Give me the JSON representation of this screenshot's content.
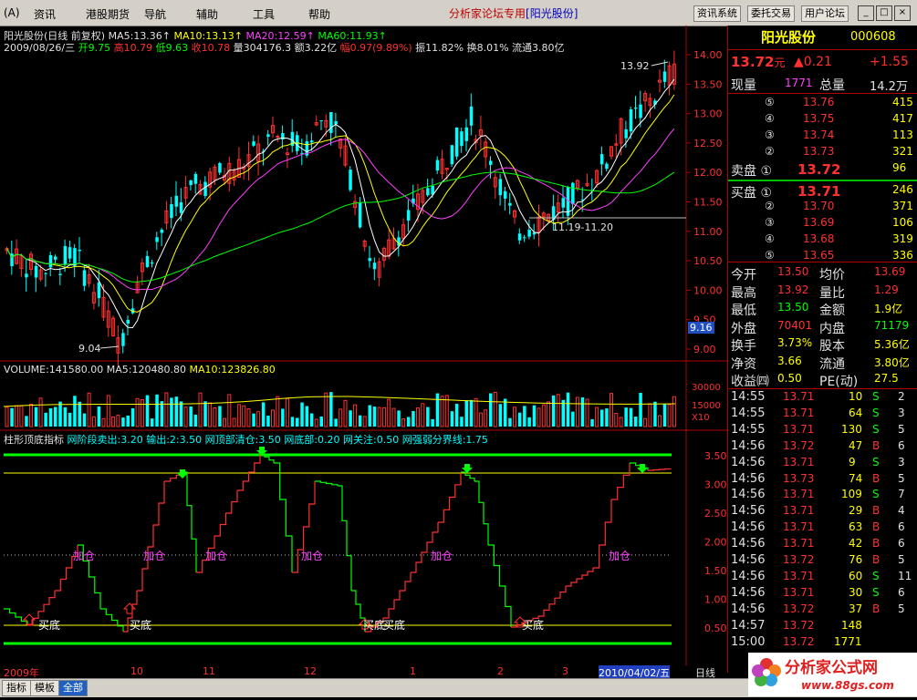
{
  "menu": [
    "(A)",
    "资讯",
    "港股期货",
    "导航",
    "辅助",
    "工具",
    "帮助"
  ],
  "window_title": {
    "prefix": "分析家论坛专用",
    "stock": "[阳光股份]"
  },
  "toolbar_buttons": [
    "资讯系统",
    "委托交易",
    "用户论坛"
  ],
  "window_controls": [
    "_",
    "□",
    "×"
  ],
  "chart_header": {
    "title": "阳光股份(日线 前复权)",
    "ma5": "MA5:13.36↑",
    "ma10": "MA10:13.13↑",
    "ma20": "MA20:12.59↑",
    "ma60": "MA60:11.93↑",
    "date": "2009/08/26/三",
    "open": "开9.75",
    "high": "高10.79",
    "low": "低9.63",
    "close": "收10.78",
    "volume": "量304176.3",
    "amount": "额3.22亿",
    "change": "幅0.97(9.89%)",
    "amplitude": "振11.82%",
    "turnover": "换8.01%",
    "float": "流通3.80亿"
  },
  "price_axis": [
    "14.00",
    "13.50",
    "13.00",
    "12.50",
    "12.00",
    "11.50",
    "11.00",
    "10.50",
    "10.00",
    "9.50",
    "9.00"
  ],
  "annotations": {
    "high": "13.92",
    "low": "9.04",
    "range": "11.19-11.20",
    "current_tag": "9.16"
  },
  "volume_header": {
    "label": "VOLUME:141580.00",
    "ma5": "MA5:120480.80",
    "ma10": "MA10:123826.80"
  },
  "volume_axis": [
    "30000",
    "15000",
    "X10"
  ],
  "indicator_header": {
    "name": "柱形顶底指标",
    "sell": "网阶段卖出:3.20",
    "out": "输出:2:3.50",
    "top": "网顶部清仓:3.50",
    "bottom": "网底部:0.20",
    "focus": "网关注:0.50",
    "line": "网强弱分界线:1.75"
  },
  "indicator_axis": [
    "3.50",
    "3.00",
    "2.50",
    "2.00",
    "1.50",
    "1.00",
    "0.50"
  ],
  "indicator_labels": {
    "add": "加仓",
    "buy": "买底"
  },
  "date_axis": [
    "2009年",
    "10",
    "11",
    "12",
    "1",
    "2",
    "3"
  ],
  "date_cursor": "2010/04/02/五",
  "period": "日线",
  "tabs": [
    "指标",
    "模板",
    "全部"
  ],
  "quote": {
    "name": "阳光股份",
    "code": "000608",
    "price": "13.72",
    "unit": "元",
    "change": "▲0.21",
    "pct": "+1.55",
    "cur_vol_label": "现量",
    "cur_vol": "1771",
    "total_vol_label": "总量",
    "total_vol": "14.2万",
    "asks": [
      {
        "lv": "⑤",
        "p": "13.76",
        "v": "415"
      },
      {
        "lv": "④",
        "p": "13.75",
        "v": "417"
      },
      {
        "lv": "③",
        "p": "13.74",
        "v": "113"
      },
      {
        "lv": "②",
        "p": "13.73",
        "v": "321"
      },
      {
        "lv": "卖盘 ①",
        "p": "13.72",
        "v": "96"
      }
    ],
    "bids": [
      {
        "lv": "买盘 ①",
        "p": "13.71",
        "v": "246"
      },
      {
        "lv": "②",
        "p": "13.70",
        "v": "371"
      },
      {
        "lv": "③",
        "p": "13.69",
        "v": "106"
      },
      {
        "lv": "④",
        "p": "13.68",
        "v": "319"
      },
      {
        "lv": "⑤",
        "p": "13.65",
        "v": "336"
      }
    ],
    "stats": [
      [
        "今开",
        "13.50",
        "均价",
        "13.69"
      ],
      [
        "最高",
        "13.92",
        "量比",
        "1.29"
      ],
      [
        "最低",
        "13.50",
        "金额",
        "1.9亿"
      ],
      [
        "外盘",
        "70401",
        "内盘",
        "71179"
      ],
      [
        "换手",
        "3.73%",
        "股本",
        "5.36亿"
      ],
      [
        "净资",
        "3.66",
        "流通",
        "3.80亿"
      ],
      [
        "收益㈣",
        "0.50",
        "PE(动)",
        "27.5"
      ]
    ],
    "ticks": [
      [
        "14:55",
        "13.71",
        "10",
        "S",
        "2"
      ],
      [
        "14:55",
        "13.71",
        "64",
        "S",
        "3"
      ],
      [
        "14:55",
        "13.71",
        "130",
        "S",
        "5"
      ],
      [
        "14:56",
        "13.72",
        "47",
        "B",
        "6"
      ],
      [
        "14:56",
        "13.71",
        "9",
        "S",
        "3"
      ],
      [
        "14:56",
        "13.73",
        "74",
        "B",
        "5"
      ],
      [
        "14:56",
        "13.71",
        "109",
        "S",
        "7"
      ],
      [
        "14:56",
        "13.71",
        "29",
        "B",
        "4"
      ],
      [
        "14:56",
        "13.71",
        "63",
        "B",
        "6"
      ],
      [
        "14:56",
        "13.71",
        "42",
        "B",
        "6"
      ],
      [
        "14:56",
        "13.72",
        "76",
        "B",
        "5"
      ],
      [
        "14:56",
        "13.71",
        "60",
        "S",
        "11"
      ],
      [
        "14:56",
        "13.71",
        "30",
        "S",
        "6"
      ],
      [
        "14:56",
        "13.72",
        "37",
        "B",
        "5"
      ],
      [
        "14:57",
        "13.72",
        "148",
        "",
        ""
      ],
      [
        "15:00",
        "13.72",
        "1771",
        "",
        ""
      ]
    ]
  },
  "logo": {
    "text": "分析家公式网",
    "url": "www.88gs.com"
  },
  "colors": {
    "up": "#ff3030",
    "down": "#00ffff",
    "ma5": "#ffffff",
    "ma10": "#ffff00",
    "ma20": "#ff40ff",
    "ma60": "#00ff00",
    "green_line": "#00ff00",
    "yellow_line": "#ffff00"
  }
}
